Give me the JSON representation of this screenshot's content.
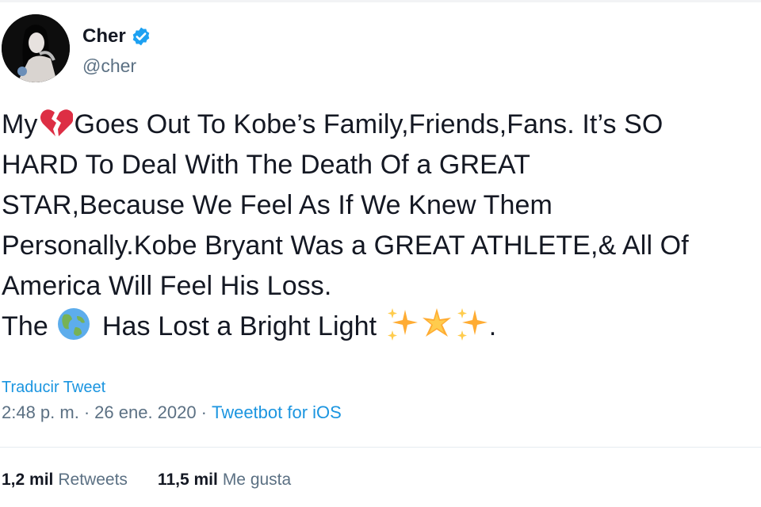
{
  "tweet": {
    "author": {
      "display_name": "Cher",
      "handle": "@cher",
      "verified": true
    },
    "text_lines": {
      "l1_a": "My",
      "l1_b": "Goes Out To Kobe’s Family,Friends,Fans. It’s SO",
      "l2": "HARD To Deal With The Death Of a GREAT",
      "l3": "STAR,Because We Feel As If We Knew Them",
      "l4": "Personally.Kobe Bryant Was a GREAT ATHLETE,& All Of",
      "l5": "America Will Feel His Loss.",
      "l6_a": "The",
      "l6_b": "Has Lost a Bright Light",
      "l6_c": "."
    },
    "emojis": [
      "broken-heart",
      "globe",
      "sparkles",
      "glowing-star",
      "sparkles"
    ],
    "translate_label": "Traducir Tweet",
    "time": "2:48 p. m.",
    "separator": "·",
    "date": "26 ene. 2020",
    "source": "Tweetbot for iOS",
    "stats": {
      "retweets_count": "1,2 mil",
      "retweets_label": "Retweets",
      "likes_count": "11,5 mil",
      "likes_label": "Me gusta"
    }
  },
  "colors": {
    "text": "#141823",
    "muted": "#5b7083",
    "link": "#1b95e0",
    "verified": "#1da1f2"
  }
}
